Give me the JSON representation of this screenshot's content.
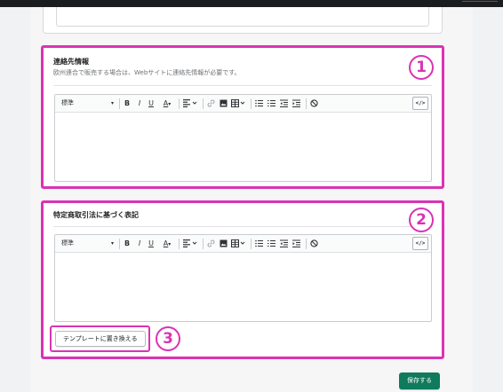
{
  "contact_section": {
    "title": "連絡先情報",
    "description": "欧州連合で販売する場合は、Webサイトに連絡先情報が必要です。",
    "marker": "1"
  },
  "legal_section": {
    "title": "特定商取引法に基づく表記",
    "marker": "2"
  },
  "editor_toolbar": {
    "format_select": "標準",
    "bold": "B",
    "italic": "I",
    "underline": "U",
    "text_color": "A",
    "code_view": "</>"
  },
  "template_button": {
    "label": "テンプレートに置き換える",
    "marker": "3"
  },
  "save_button": {
    "label": "保存する"
  },
  "colors": {
    "highlight": "#d933b4",
    "primary": "#0f7a5c"
  }
}
